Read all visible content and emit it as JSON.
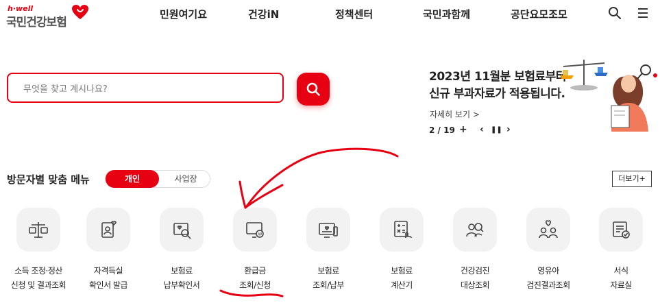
{
  "header": {
    "logo_small": "h·well",
    "logo_text": "국민건강보험",
    "nav": [
      "민원여기요",
      "건강iN",
      "정책센터",
      "국민과함께",
      "공단요모조모"
    ]
  },
  "search": {
    "placeholder": "무엇을 찾고 계시나요?"
  },
  "banner": {
    "title_line1": "2023년 11월분 보험료부터",
    "title_line2": "신규 부과자료가 적용됩니다.",
    "more": "자세히 보기 >",
    "pager": "2 / 19",
    "controls": {
      "plus": "+",
      "prev": "‹",
      "pause": "❚❚",
      "next": "›"
    }
  },
  "visitor_menu": {
    "title": "방문자별 맞춤 메뉴",
    "toggle_on": "개인",
    "toggle_off": "사업장",
    "more": "더보기+",
    "items": [
      {
        "line1": "소득 조정·정산",
        "line2": "신청 및 결과조회",
        "icon": "scale-icon"
      },
      {
        "line1": "자격득실",
        "line2": "확인서 발급",
        "icon": "certificate-icon"
      },
      {
        "line1": "보험료",
        "line2": "납부확인서",
        "icon": "document-search-icon"
      },
      {
        "line1": "환급금",
        "line2": "조회/신청",
        "icon": "refund-monitor-icon"
      },
      {
        "line1": "보험료",
        "line2": "조회/납부",
        "icon": "monitor-heart-icon"
      },
      {
        "line1": "보험료",
        "line2": "계산기",
        "icon": "calculator-icon"
      },
      {
        "line1": "건강검진",
        "line2": "대상조회",
        "icon": "people-search-icon"
      },
      {
        "line1": "영유아",
        "line2": "검진결과조회",
        "icon": "family-heart-icon"
      },
      {
        "line1": "서식",
        "line2": "자료실",
        "icon": "form-icon"
      }
    ]
  },
  "colors": {
    "brand": "#e60012",
    "annotation": "#e60012",
    "tile": "#f2f2f2"
  }
}
